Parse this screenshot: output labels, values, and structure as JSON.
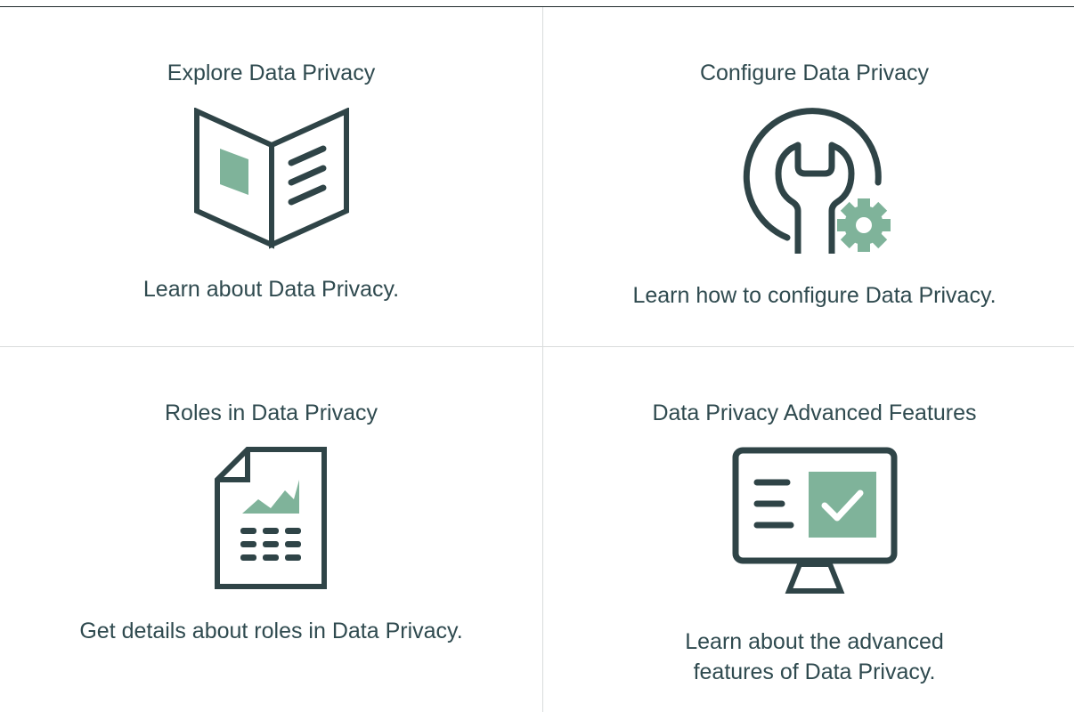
{
  "tiles": [
    {
      "title": "Explore Data Privacy",
      "description": "Learn about Data Privacy.",
      "icon": "open-book-icon"
    },
    {
      "title": "Configure Data Privacy",
      "description": "Learn how to configure Data Privacy.",
      "icon": "wrench-gear-icon"
    },
    {
      "title": "Roles in Data Privacy",
      "description": "Get details about roles in Data Privacy.",
      "icon": "report-document-icon"
    },
    {
      "title": "Data Privacy Advanced Features",
      "description": "Learn about the advanced features of Data Privacy.",
      "icon": "monitor-checkbox-icon"
    }
  ],
  "colors": {
    "icon_dark": "#2f4447",
    "icon_accent": "#7fb39a",
    "text": "#2f4a4f",
    "divider": "#d9dcdc"
  }
}
